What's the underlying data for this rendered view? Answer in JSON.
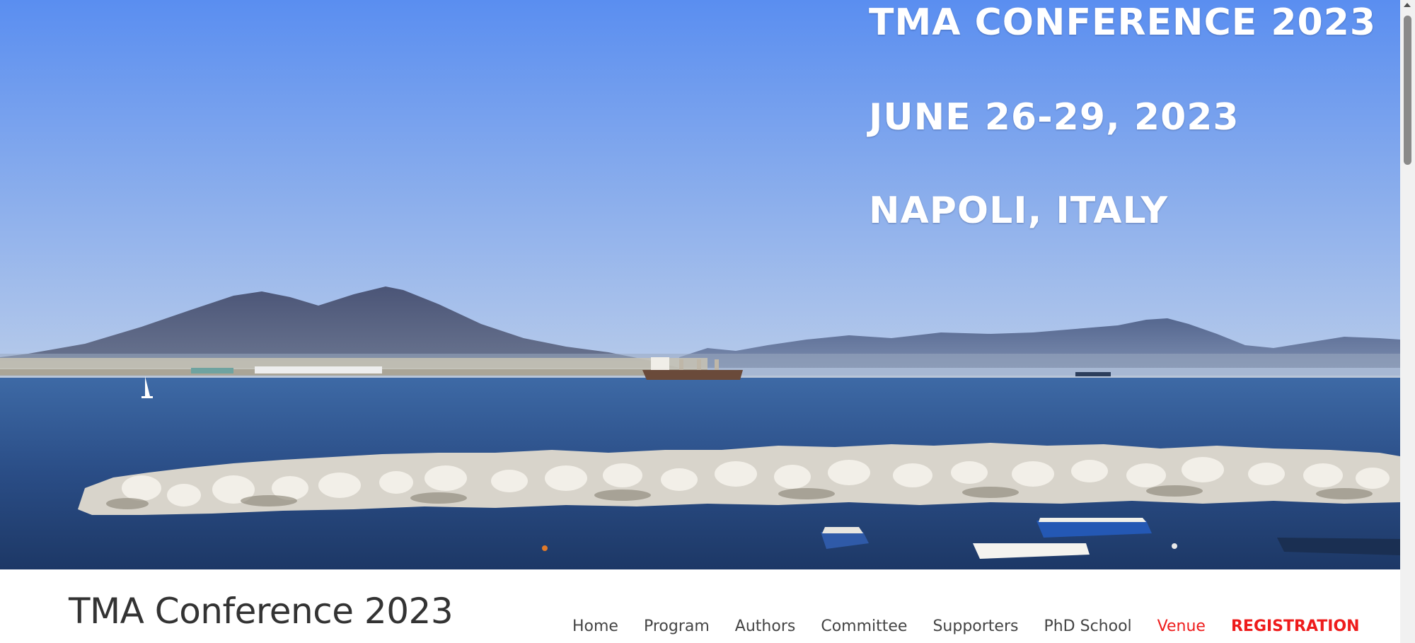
{
  "hero": {
    "lines": [
      "TMA CONFERENCE 2023",
      "JUNE 26-29, 2023",
      "NAPOLI, ITALY"
    ],
    "image": "Bay of Naples with Mount Vesuvius, breakwater rocks and small boats"
  },
  "header": {
    "site_title": "TMA Conference 2023",
    "nav": [
      "Home",
      "Program",
      "Authors",
      "Committee",
      "Supporters",
      "PhD School",
      "Venue",
      "REGISTRATION"
    ]
  },
  "colors": {
    "nav_text": "#444444",
    "nav_highlight": "#ee1c1c",
    "sky_top": "#5b8ff0",
    "sea": "#25477d"
  }
}
